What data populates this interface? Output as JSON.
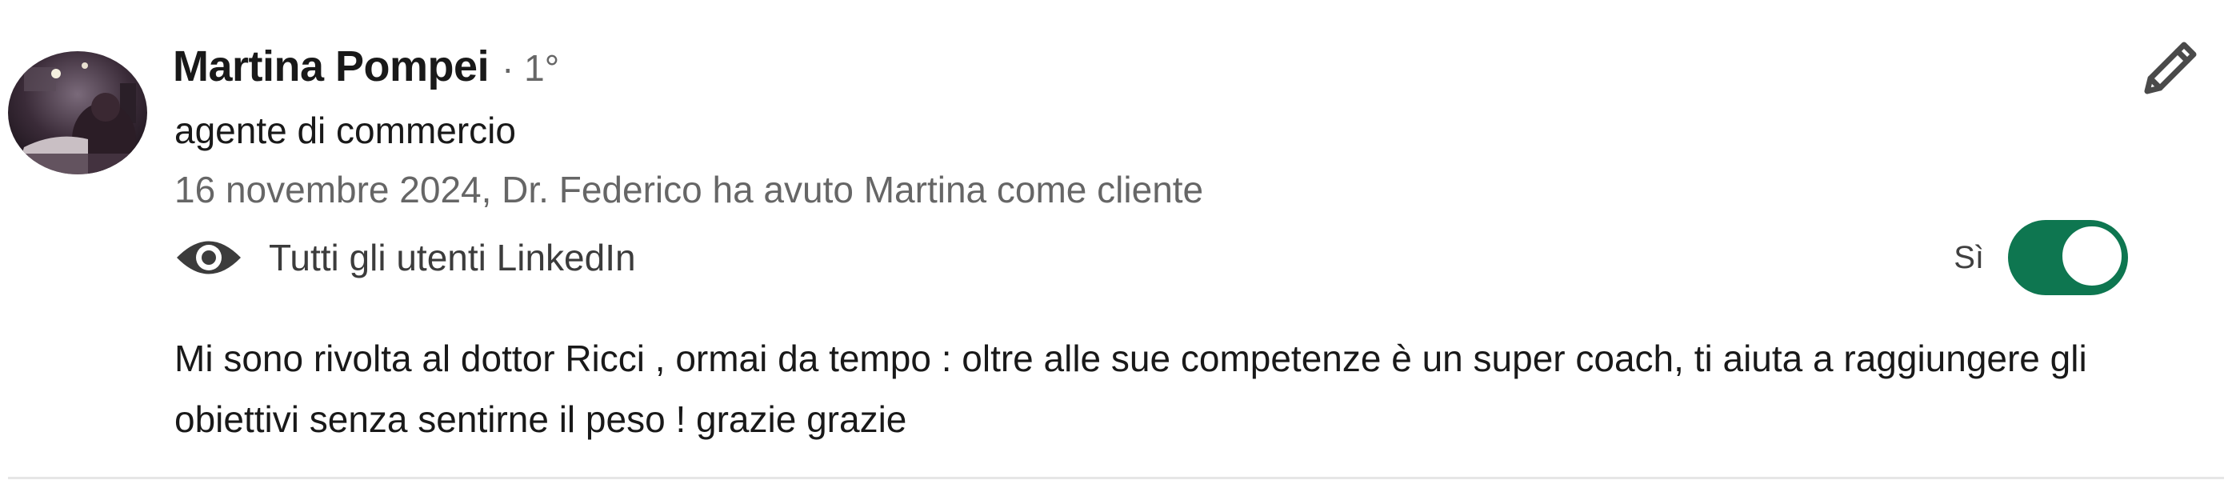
{
  "recommendation": {
    "author": {
      "name": "Martina Pompei",
      "degree": "· 1°",
      "headline": "agente di commercio",
      "avatar_icon": "profile-photo"
    },
    "meta": "16 novembre 2024, Dr. Federico ha avuto Martina come cliente",
    "visibility": {
      "icon": "eye-icon",
      "label": "Tutti gli utenti LinkedIn"
    },
    "toggle": {
      "label": "Sì",
      "state": "on",
      "color": "#0e7650"
    },
    "edit_icon": "pencil-icon",
    "text": "Mi sono rivolta al dottor Ricci , ormai da tempo : oltre alle sue competenze è un super coach, ti aiuta a raggiungere gli obiettivi senza sentirne il peso ! grazie grazie"
  }
}
